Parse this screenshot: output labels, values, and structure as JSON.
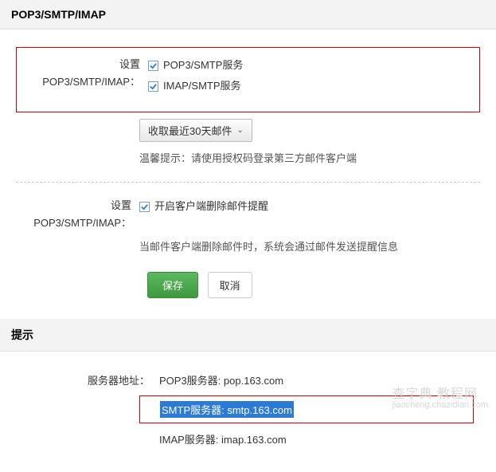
{
  "section1": {
    "title": "POP3/SMTP/IMAP",
    "settingLabel": "设置POP3/SMTP/IMAP：",
    "pop3smtp": "POP3/SMTP服务",
    "imapsmtp": "IMAP/SMTP服务",
    "fetchRecent": "收取最近30天邮件",
    "hint": "温馨提示：请使用授权码登录第三方邮件客户端",
    "settingLabel2": "设置POP3/SMTP/IMAP：",
    "deleteNotify": "开启客户端删除邮件提醒",
    "deleteHint": "当邮件客户端删除邮件时，系统会通过邮件发送提醒信息",
    "saveBtn": "保存",
    "cancelBtn": "取消"
  },
  "section2": {
    "title": "提示",
    "serverAddrLabel": "服务器地址：",
    "pop3": "POP3服务器: pop.163.com",
    "smtp": "SMTP服务器: smtp.163.com",
    "imap": "IMAP服务器: imap.163.com"
  },
  "watermark": {
    "main": "查字典   教程网",
    "sub": "jiaocheng.chazidian.com"
  }
}
